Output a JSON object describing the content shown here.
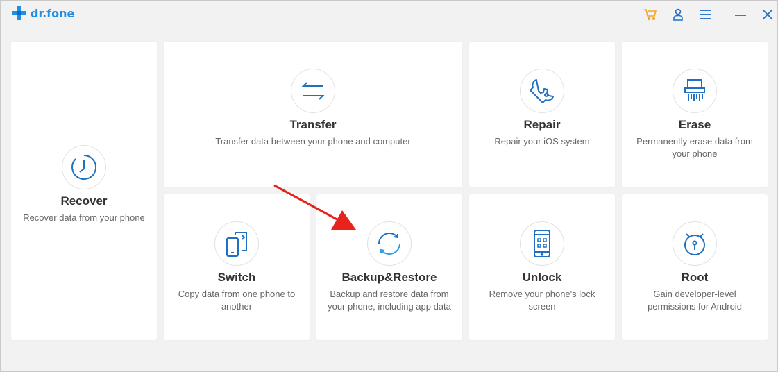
{
  "app": {
    "logo_text": "dr.fone",
    "brand_color": "#1f8fe5",
    "accent_color": "#f5a623"
  },
  "titlebar": {
    "icons": [
      "cart-icon",
      "account-icon",
      "menu-icon",
      "minimize-icon",
      "close-icon"
    ]
  },
  "cards": {
    "recover": {
      "title": "Recover",
      "desc": "Recover data from your phone",
      "icon": "clock-icon"
    },
    "transfer": {
      "title": "Transfer",
      "desc": "Transfer data between your phone and computer",
      "icon": "transfer-arrows-icon"
    },
    "repair": {
      "title": "Repair",
      "desc": "Repair your iOS system",
      "icon": "wrench-icon"
    },
    "erase": {
      "title": "Erase",
      "desc": "Permanently erase data from your phone",
      "icon": "shredder-icon"
    },
    "switch": {
      "title": "Switch",
      "desc": "Copy data from one phone to another",
      "icon": "phone-switch-icon"
    },
    "backup": {
      "title": "Backup&Restore",
      "desc": "Backup and restore data from your phone, including app data",
      "icon": "sync-icon"
    },
    "unlock": {
      "title": "Unlock",
      "desc": "Remove your phone's lock screen",
      "icon": "phone-lock-icon"
    },
    "root": {
      "title": "Root",
      "desc": "Gain developer-level permissions for Android",
      "icon": "android-root-icon"
    }
  },
  "annotation": {
    "arrow_color": "#e8231c"
  }
}
